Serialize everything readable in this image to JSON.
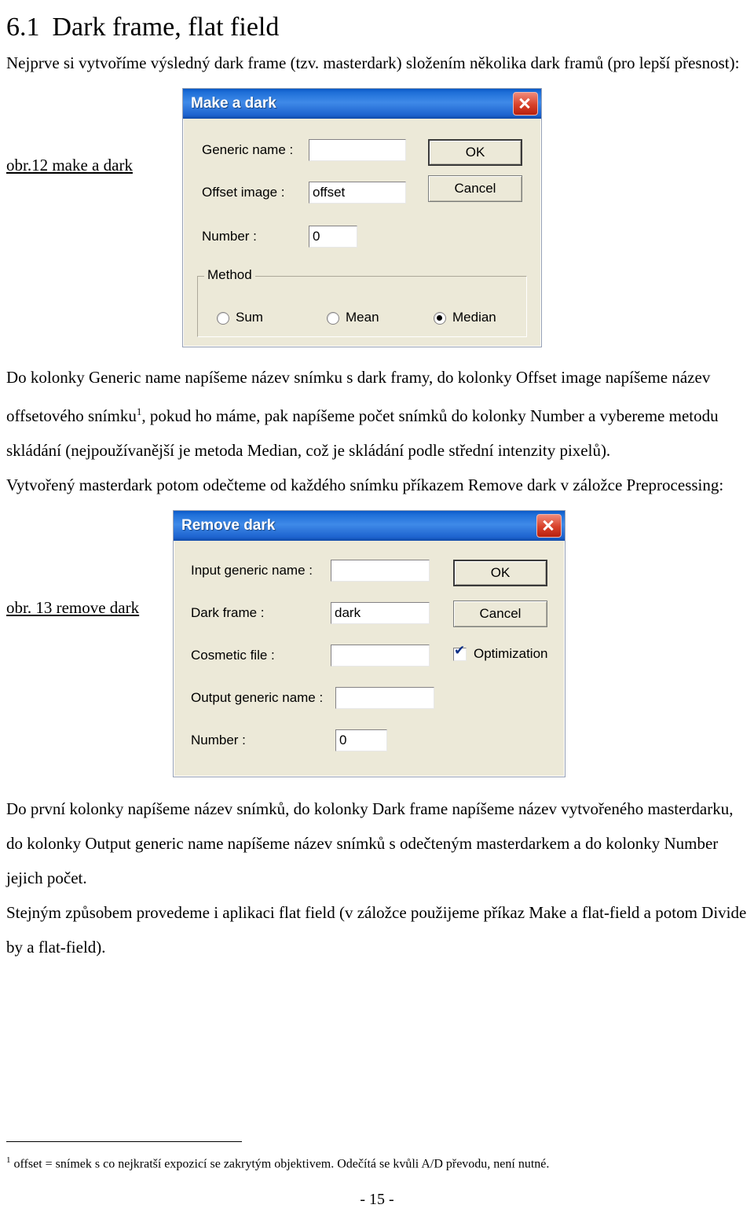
{
  "document": {
    "heading": {
      "number": "6.1",
      "title": "Dark frame, flat field"
    },
    "paragraphs": [
      "Nejprve si vytvoříme výsledný dark frame (tzv. masterdark) složením několika dark framů (pro lepší přesnost):",
      "Do kolonky Generic name napíšeme název snímku s dark framy, do kolonky Offset image napíšeme název offsetového snímku",
      ", pokud ho máme, pak napíšeme počet snímků do kolonky Number a vybereme metodu skládání (nejpoužívanější je metoda Median, což je skládání podle střední intenzity pixelů).",
      "Vytvořený masterdark potom odečteme od každého snímku příkazem Remove dark v záložce Preprocessing:",
      "Do první kolonky napíšeme název snímků, do kolonky Dark frame napíšeme název vytvořeného masterdarku, do kolonky Output generic name napíšeme název snímků s odečteným masterdarkem a do kolonky Number jejich počet.",
      "Stejným způsobem provedeme i aplikaci flat field (v záložce použijeme příkaz Make a flat-field a potom Divide by a flat-field)."
    ],
    "footnote_marker": "1",
    "footnote": "offset = snímek s co nejkratší expozicí se zakrytým objektivem. Odečítá se kvůli A/D převodu, není nutné.",
    "page_number": "- 15 -"
  },
  "figures": [
    {
      "caption": "obr.12 make a dark",
      "dialog": {
        "title": "Make a dark",
        "close_icon": "close-icon",
        "fields": [
          {
            "label": "Generic name :",
            "value": ""
          },
          {
            "label": "Offset image :",
            "value": "offset"
          },
          {
            "label": "Number :",
            "value": "0"
          }
        ],
        "buttons": [
          {
            "label": "OK",
            "default": true
          },
          {
            "label": "Cancel",
            "default": false
          }
        ],
        "group": {
          "label": "Method",
          "options": [
            {
              "label": "Sum",
              "selected": false
            },
            {
              "label": "Mean",
              "selected": false
            },
            {
              "label": "Median",
              "selected": true
            }
          ]
        }
      }
    },
    {
      "caption": "obr. 13 remove dark",
      "dialog": {
        "title": "Remove dark",
        "close_icon": "close-icon",
        "fields": [
          {
            "label": "Input generic name :",
            "value": ""
          },
          {
            "label": "Dark frame :",
            "value": "dark"
          },
          {
            "label": "Cosmetic file :",
            "value": ""
          },
          {
            "label": "Output generic name :",
            "value": ""
          },
          {
            "label": "Number :",
            "value": "0"
          }
        ],
        "buttons": [
          {
            "label": "OK",
            "default": true
          },
          {
            "label": "Cancel",
            "default": false
          }
        ],
        "checkbox": {
          "label": "Optimization",
          "checked": true
        }
      }
    }
  ]
}
